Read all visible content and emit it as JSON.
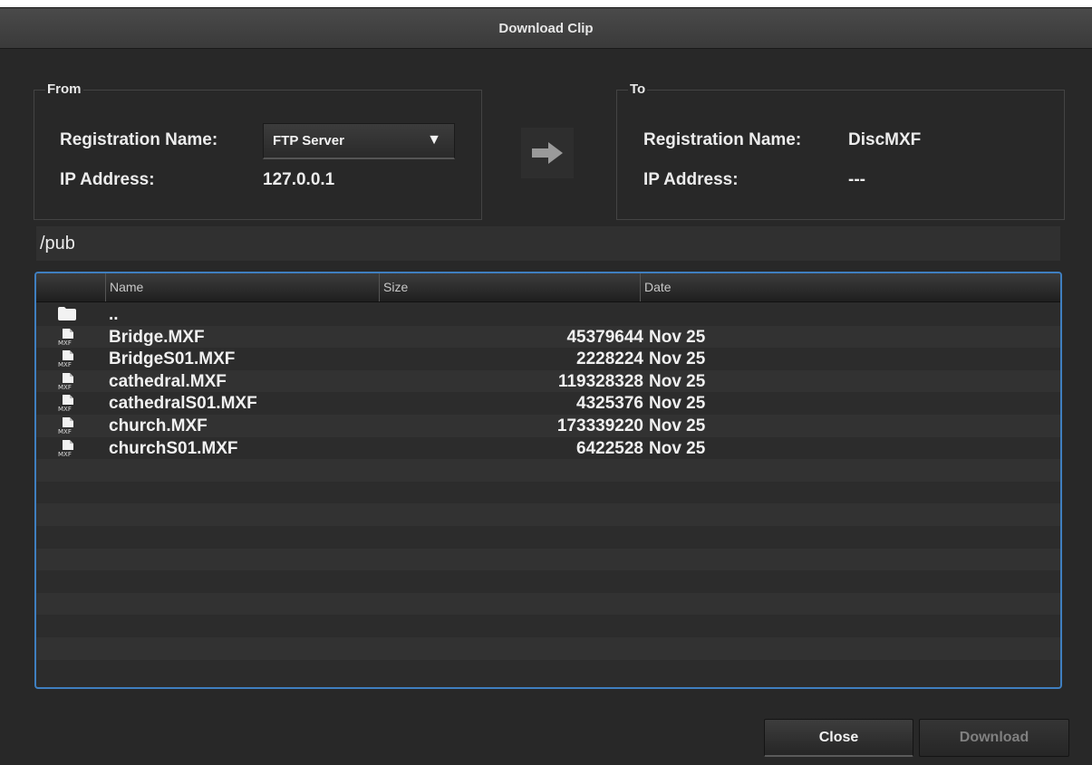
{
  "window": {
    "title": "Download Clip"
  },
  "from": {
    "legend": "From",
    "registration_label": "Registration Name:",
    "registration_value": "FTP Server",
    "ip_label": "IP Address:",
    "ip_value": "127.0.0.1"
  },
  "to": {
    "legend": "To",
    "registration_label": "Registration Name:",
    "registration_value": "DiscMXF",
    "ip_label": "IP Address:",
    "ip_value": "---"
  },
  "path": "/pub",
  "file_list": {
    "columns": {
      "name": "Name",
      "size": "Size",
      "date": "Date"
    },
    "parent": {
      "name": "..",
      "icon": "folder-icon"
    },
    "files": [
      {
        "name": "Bridge.MXF",
        "size": "45379644",
        "date": "Nov 25",
        "icon": "mxf-file-icon",
        "icon_label": "MXF"
      },
      {
        "name": "BridgeS01.MXF",
        "size": "2228224",
        "date": "Nov 25",
        "icon": "mxf-file-icon",
        "icon_label": "MXF"
      },
      {
        "name": "cathedral.MXF",
        "size": "119328328",
        "date": "Nov 25",
        "icon": "mxf-file-icon",
        "icon_label": "MXF"
      },
      {
        "name": "cathedralS01.MXF",
        "size": "4325376",
        "date": "Nov 25",
        "icon": "mxf-file-icon",
        "icon_label": "MXF"
      },
      {
        "name": "church.MXF",
        "size": "173339220",
        "date": "Nov 25",
        "icon": "mxf-file-icon",
        "icon_label": "MXF"
      },
      {
        "name": "churchS01.MXF",
        "size": "6422528",
        "date": "Nov 25",
        "icon": "mxf-file-icon",
        "icon_label": "MXF"
      }
    ]
  },
  "buttons": {
    "close": "Close",
    "download": "Download"
  },
  "colors": {
    "window_bg": "#282828",
    "focus_ring": "#3f7fc0",
    "text": "#f0f0f0",
    "disabled_text": "#808080"
  }
}
